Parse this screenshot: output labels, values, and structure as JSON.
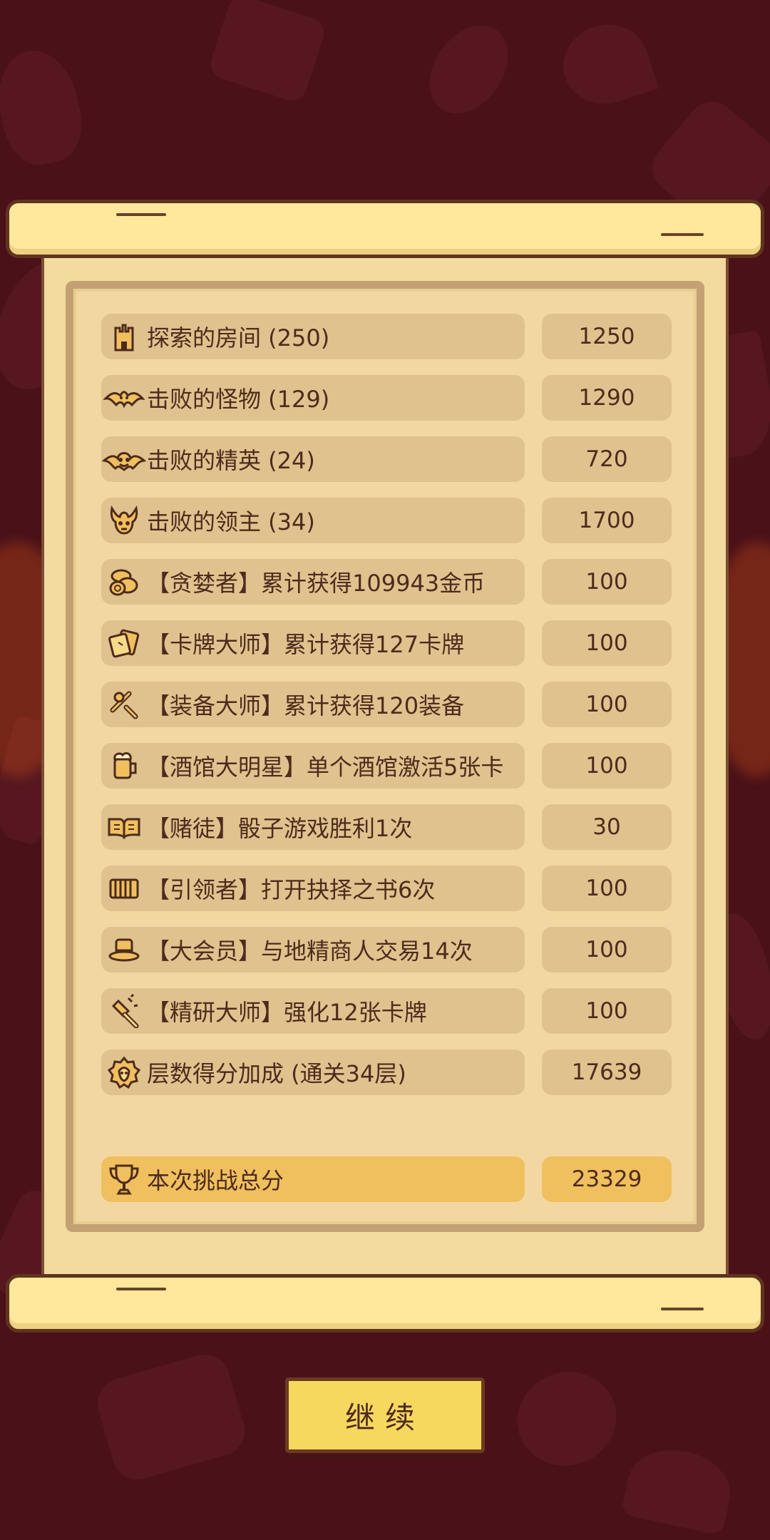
{
  "screen": {
    "title": ""
  },
  "colors": {
    "background": "#4a1119",
    "paper": "#f3dba0",
    "row": "#dfc28e",
    "total_row": "#f0c05f",
    "button": "#f7d85f",
    "text": "#4d2b1c"
  },
  "score_rows": [
    {
      "icon": "tower-icon",
      "label": "探索的房间 (250)",
      "value": "1250"
    },
    {
      "icon": "bat-icon",
      "label": "击败的怪物 (129)",
      "value": "1290"
    },
    {
      "icon": "demon-face-icon",
      "label": "击败的精英 (24)",
      "value": "720"
    },
    {
      "icon": "boss-skull-icon",
      "label": "击败的领主 (34)",
      "value": "1700"
    },
    {
      "icon": "gold-coins-icon",
      "label": "【贪婪者】累计获得109943金币",
      "value": "100"
    },
    {
      "icon": "cards-icon",
      "label": "【卡牌大师】累计获得127卡牌",
      "value": "100"
    },
    {
      "icon": "equipment-icon",
      "label": "【装备大师】累计获得120装备",
      "value": "100"
    },
    {
      "icon": "beer-mug-icon",
      "label": "【酒馆大明星】单个酒馆激活5张卡",
      "value": "100"
    },
    {
      "icon": "open-book-icon",
      "label": "【赌徒】骰子游戏胜利1次",
      "value": "30"
    },
    {
      "icon": "closed-book-icon",
      "label": "【引领者】打开抉择之书6次",
      "value": "100"
    },
    {
      "icon": "top-hat-icon",
      "label": "【大会员】与地精商人交易14次",
      "value": "100"
    },
    {
      "icon": "hammer-icon",
      "label": "【精研大师】强化12张卡牌",
      "value": "100"
    },
    {
      "icon": "floor-bonus-icon",
      "label": "层数得分加成 (通关34层)",
      "value": "17639"
    }
  ],
  "total": {
    "icon": "trophy-icon",
    "label": "本次挑战总分",
    "value": "23329"
  },
  "continue_button": {
    "label": "继续"
  }
}
